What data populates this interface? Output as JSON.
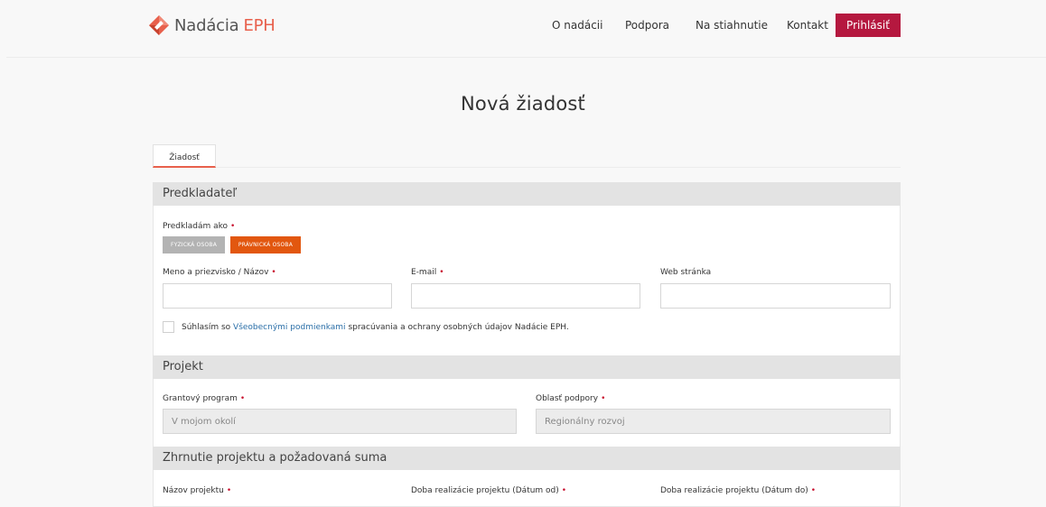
{
  "header": {
    "brand": "Nadácia",
    "brand_accent": "EPH",
    "nav": [
      {
        "label": "O nadácii"
      },
      {
        "label": "Podpora"
      },
      {
        "label": "Na stiahnutie"
      },
      {
        "label": "Kontakt"
      }
    ],
    "login_label": "Prihlásiť",
    "accent_color": "#b5183f",
    "logo_color": "#e8604c"
  },
  "page_title": "Nová žiadosť",
  "tabs": [
    {
      "label": "Žiadosť",
      "active": true
    }
  ],
  "sections": {
    "applicant": {
      "title": "Predkladateľ",
      "submit_as_label": "Predkladám ako",
      "person_type_options": [
        {
          "label": "FYZICKÁ OSOBA",
          "selected": false
        },
        {
          "label": "PRÁVNICKÁ OSOBA",
          "selected": true
        }
      ],
      "name_label": "Meno a priezvisko / Názov",
      "email_label": "E-mail",
      "web_label": "Web stránka",
      "consent_before": "Súhlasím so",
      "consent_link": "Všeobecnými podmienkami",
      "consent_after": "spracúvania a ochrany osobných údajov Nadácie EPH."
    },
    "project": {
      "title": "Projekt",
      "program_label": "Grantový program",
      "program_value": "V mojom okolí",
      "area_label": "Oblasť podpory",
      "area_value": "Regionálny rozvoj"
    },
    "summary": {
      "title": "Zhrnutie projektu a požadovaná suma",
      "project_name_label": "Názov projektu",
      "date_from_label": "Doba realizácie projektu (Dátum od)",
      "date_to_label": "Doba realizácie projektu (Dátum do)"
    }
  },
  "required_mark": "•"
}
